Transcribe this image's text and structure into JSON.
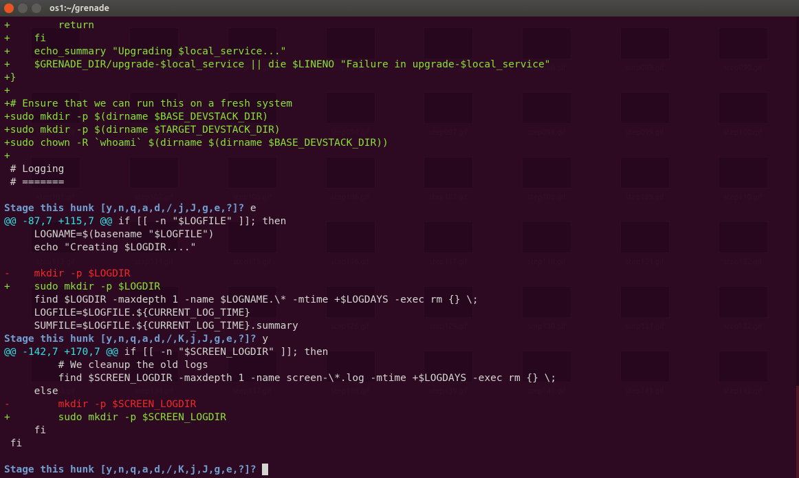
{
  "window": {
    "title": "os1:~/grenade"
  },
  "bg_files": [
    "step081.gif",
    "step082.gif",
    "step083.gif",
    "step084.gif",
    "step085.gif",
    "step086.gif",
    "step089.gif",
    "step090.gif",
    "step091.gif",
    "step092.gif",
    "step093.gif",
    "step094.gif",
    "step097.gif",
    "step098.gif",
    "step099.gif",
    "step100.gif",
    "step101.gif",
    "step102.gif",
    "step105.gif",
    "step106.gif",
    "step107.gif",
    "step108.gif",
    "step109.gif",
    "step110.gif",
    "step113.gif",
    "step114.gif",
    "step115.gif",
    "step116.gif",
    "step117.gif",
    "step118.gif",
    "step121.gif",
    "step122.gif",
    "step123.gif",
    "step124.gif",
    "step125.gif",
    "step126.gif",
    "step129.gif",
    "step130.gif",
    "step131.gif",
    "step132.gif",
    "step133.gif",
    "step134.gif",
    "step137.gif",
    "step138.gif",
    "step139.gif",
    "step140.gif",
    "step141.gif",
    "step142.gif"
  ],
  "lines": [
    {
      "c": "add",
      "t": "+        return"
    },
    {
      "c": "add",
      "t": "+    fi"
    },
    {
      "c": "add",
      "t": "+    echo_summary \"Upgrading $local_service...\""
    },
    {
      "c": "add",
      "t": "+    $GRENADE_DIR/upgrade-$local_service || die $LINENO \"Failure in upgrade-$local_service\""
    },
    {
      "c": "add",
      "t": "+}"
    },
    {
      "c": "add",
      "t": "+"
    },
    {
      "c": "add",
      "t": "+# Ensure that we can run this on a fresh system"
    },
    {
      "c": "add",
      "t": "+sudo mkdir -p $(dirname $BASE_DEVSTACK_DIR)"
    },
    {
      "c": "add",
      "t": "+sudo mkdir -p $(dirname $TARGET_DEVSTACK_DIR)"
    },
    {
      "c": "add",
      "t": "+sudo chown -R `whoami` $(dirname $(dirname $BASE_DEVSTACK_DIR))"
    },
    {
      "c": "add",
      "t": "+"
    },
    {
      "c": "neu",
      "t": " # Logging"
    },
    {
      "c": "neu",
      "t": " # ======="
    },
    {
      "c": "neu",
      "t": " "
    },
    {
      "c": "pmt",
      "t": "Stage this hunk [y,n,q,a,d,/,j,J,g,e,?]? ",
      "after": "e",
      "after_c": "neu"
    },
    {
      "c": "hnk",
      "t": "@@ -87,7 +115,7 @@",
      "after": " if [[ -n \"$LOGFILE\" ]]; then",
      "after_c": "neu"
    },
    {
      "c": "neu",
      "t": "     LOGNAME=$(basename \"$LOGFILE\")"
    },
    {
      "c": "neu",
      "t": "     echo \"Creating $LOGDIR....\""
    },
    {
      "c": "neu",
      "t": " "
    },
    {
      "c": "del",
      "t": "-    mkdir -p $LOGDIR"
    },
    {
      "c": "add",
      "t": "+    sudo mkdir -p $LOGDIR"
    },
    {
      "c": "neu",
      "t": "     find $LOGDIR -maxdepth 1 -name $LOGNAME.\\* -mtime +$LOGDAYS -exec rm {} \\;"
    },
    {
      "c": "neu",
      "t": "     LOGFILE=$LOGFILE.${CURRENT_LOG_TIME}"
    },
    {
      "c": "neu",
      "t": "     SUMFILE=$LOGFILE.${CURRENT_LOG_TIME}.summary"
    },
    {
      "c": "pmt",
      "t": "Stage this hunk [y,n,q,a,d,/,K,j,J,g,e,?]? ",
      "after": "y",
      "after_c": "neu"
    },
    {
      "c": "hnk",
      "t": "@@ -142,7 +170,7 @@",
      "after": " if [[ -n \"$SCREEN_LOGDIR\" ]]; then",
      "after_c": "neu"
    },
    {
      "c": "neu",
      "t": "         # We cleanup the old logs"
    },
    {
      "c": "neu",
      "t": "         find $SCREEN_LOGDIR -maxdepth 1 -name screen-\\*.log -mtime +$LOGDAYS -exec rm {} \\;"
    },
    {
      "c": "neu",
      "t": "     else"
    },
    {
      "c": "del",
      "t": "-        mkdir -p $SCREEN_LOGDIR"
    },
    {
      "c": "add",
      "t": "+        sudo mkdir -p $SCREEN_LOGDIR"
    },
    {
      "c": "neu",
      "t": "     fi"
    },
    {
      "c": "neu",
      "t": " fi"
    },
    {
      "c": "neu",
      "t": " "
    },
    {
      "c": "pmt",
      "t": "Stage this hunk [y,n,q,a,d,/,K,j,J,g,e,?]? ",
      "cursor": true
    }
  ]
}
